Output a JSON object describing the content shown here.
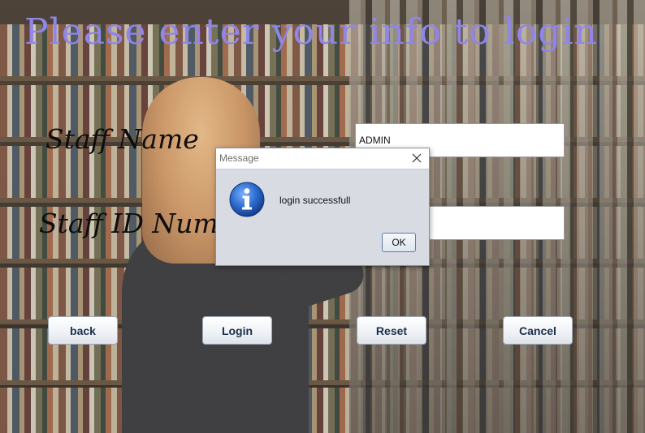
{
  "title": "Please enter your info to login",
  "form": {
    "staff_name_label": "Staff Name",
    "staff_id_label": "Staff  ID Num",
    "staff_name_value": "ADMIN",
    "staff_id_value": ""
  },
  "buttons": {
    "back": "back",
    "login": "Login",
    "reset": "Reset",
    "cancel": "Cancel"
  },
  "dialog": {
    "title": "Message",
    "message": "login successfull",
    "ok_label": "OK",
    "icon": "info-icon"
  },
  "colors": {
    "title": "#8f86e6",
    "button_text": "#1a2f4d",
    "dialog_bg": "#d8dbe2"
  }
}
